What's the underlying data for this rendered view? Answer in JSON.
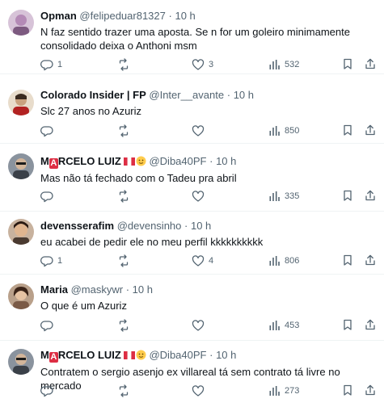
{
  "tweets": [
    {
      "name": "Opman",
      "handle": "@felipeduar81327",
      "time": "10 h",
      "text": "N faz sentido trazer uma aposta. Se n for um goleiro minimamente consolidado deixa o Anthoni msm",
      "replies": "1",
      "reposts": "",
      "likes": "3",
      "views": "532",
      "avatar_color": "#c9b2c9"
    },
    {
      "name": "Colorado Insider | FP",
      "handle": "@Inter__avante",
      "time": "10 h",
      "text": "Slc 27 anos no Azuriz",
      "replies": "",
      "reposts": "",
      "likes": "",
      "views": "850",
      "avatar_color": "#d9c2a8"
    },
    {
      "name_a": "M",
      "name_badge": "A",
      "name_b": "RCELO LUIZ",
      "handle": "@Diba40PF",
      "time": "10 h",
      "text": "Mas não tá fechado com o Tadeu pra abril",
      "replies": "",
      "reposts": "",
      "likes": "",
      "views": "335",
      "avatar_color": "#5b6470"
    },
    {
      "name": "devensserafim",
      "handle": "@devensinho",
      "time": "10 h",
      "text": "eu acabei de pedir ele no meu perfil kkkkkkkkkk",
      "replies": "1",
      "reposts": "",
      "likes": "4",
      "views": "806",
      "avatar_color": "#6b4a3a"
    },
    {
      "name": "Maria",
      "handle": "@maskywr",
      "time": "10 h",
      "text": "O que é um Azuriz",
      "replies": "",
      "reposts": "",
      "likes": "",
      "views": "453",
      "avatar_color": "#a07a62"
    },
    {
      "name_a": "M",
      "name_badge": "A",
      "name_b": "RCELO LUIZ",
      "handle": "@Diba40PF",
      "time": "10 h",
      "text": "Contratem o sergio asenjo ex villareal tá sem contrato  tá livre no mercado",
      "replies": "",
      "reposts": "",
      "likes": "",
      "views": "273",
      "avatar_color": "#5b6470"
    }
  ],
  "separator": "·",
  "colors": {
    "text": "#0f1419",
    "secondary": "#536471",
    "divider": "#eff3f4",
    "flag_red": "#dd2e44"
  },
  "icons": [
    "reply-icon",
    "repost-icon",
    "like-icon",
    "views-icon",
    "bookmark-icon",
    "share-icon"
  ]
}
